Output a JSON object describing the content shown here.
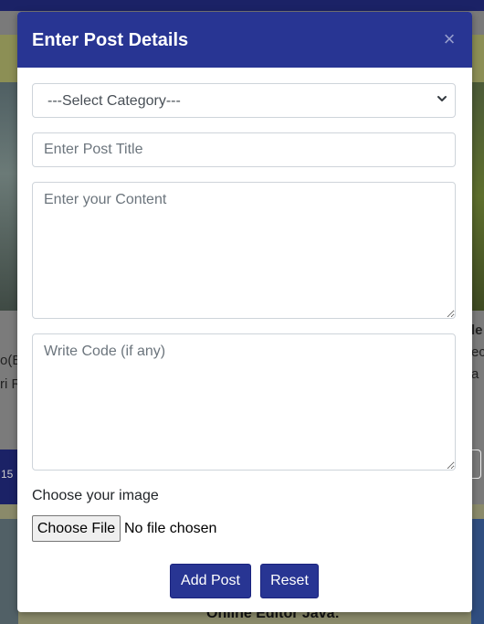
{
  "background": {
    "left_text_lines": [
      "o(B",
      "ri R"
    ],
    "right_text_lines": [
      "le",
      "ec",
      "a"
    ],
    "left_pill_text": "15",
    "bottom_caption": "Online Editor Java:"
  },
  "modal": {
    "title": "Enter Post Details",
    "close_symbol": "×",
    "category_select": {
      "selected": "---Select Category---"
    },
    "post_title": {
      "placeholder": "Enter Post Title",
      "value": ""
    },
    "content": {
      "placeholder": "Enter your Content",
      "value": ""
    },
    "code": {
      "placeholder": "Write Code (if any)",
      "value": ""
    },
    "image": {
      "label": "Choose your image",
      "button_label": "Choose File",
      "status": "No file chosen"
    },
    "buttons": {
      "add": "Add Post",
      "reset": "Reset"
    }
  },
  "colors": {
    "header": "#283593",
    "button": "#283593",
    "border": "#ced4da"
  },
  "icons": {
    "select_arrow": "chevron-down-icon",
    "close": "close-icon"
  }
}
